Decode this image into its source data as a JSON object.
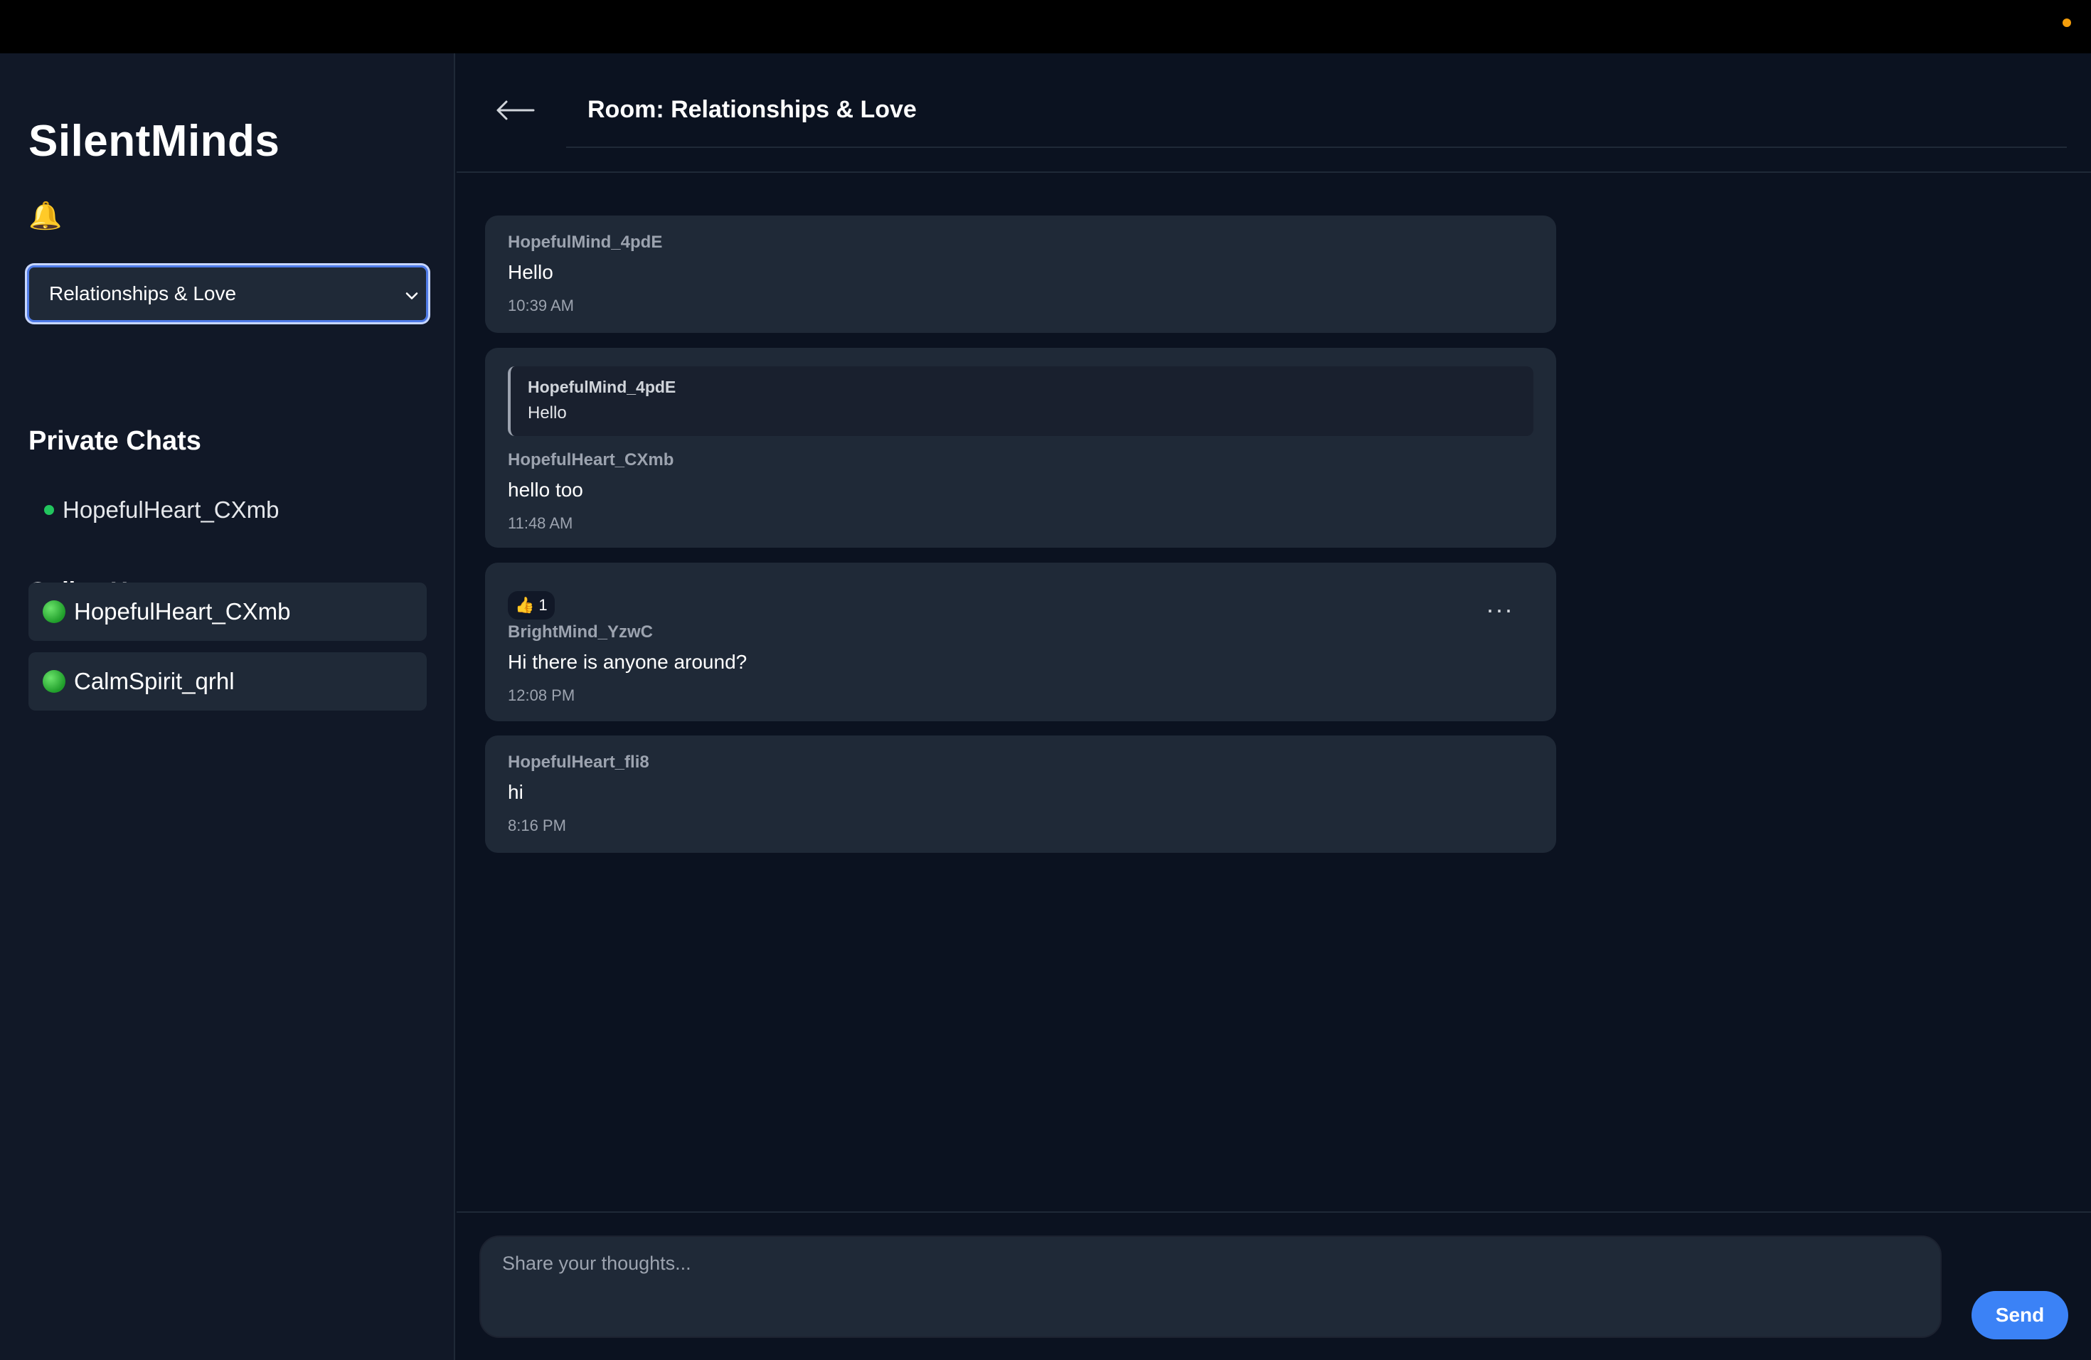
{
  "app": {
    "title": "SilentMinds"
  },
  "sidebar": {
    "bell": "🔔",
    "room_select": {
      "value": "Relationships & Love"
    },
    "private_chats": {
      "title": "Private Chats",
      "items": [
        {
          "name": "HopefulHeart_CXmb",
          "status": "online"
        }
      ]
    },
    "online_users": {
      "title": "Online Users",
      "items": [
        {
          "name": "HopefulHeart_CXmb",
          "status": "online"
        },
        {
          "name": "CalmSpirit_qrhl",
          "status": "online"
        }
      ]
    }
  },
  "main": {
    "header": {
      "back": "←",
      "title": "Room: Relationships & Love"
    },
    "messages": [
      {
        "author": "HopefulMind_4pdE",
        "text": "Hello",
        "time": "10:39 AM"
      },
      {
        "reply_to": {
          "author": "HopefulMind_4pdE",
          "text": "Hello"
        },
        "author": "HopefulHeart_CXmb",
        "text": "hello too",
        "time": "11:48 AM"
      },
      {
        "reaction": {
          "emoji": "👍",
          "count": "1"
        },
        "more": "···",
        "author": "BrightMind_YzwC",
        "text": "Hi there is anyone around?",
        "time": "12:08 PM"
      },
      {
        "author": "HopefulHeart_fli8",
        "text": "hi",
        "time": "8:16 PM"
      }
    ],
    "composer": {
      "placeholder": "Share your thoughts...",
      "send_label": "Send"
    }
  },
  "colors": {
    "accent": "#3b82f6",
    "online": "#22c55e",
    "notification_dot": "#f59e0b"
  }
}
